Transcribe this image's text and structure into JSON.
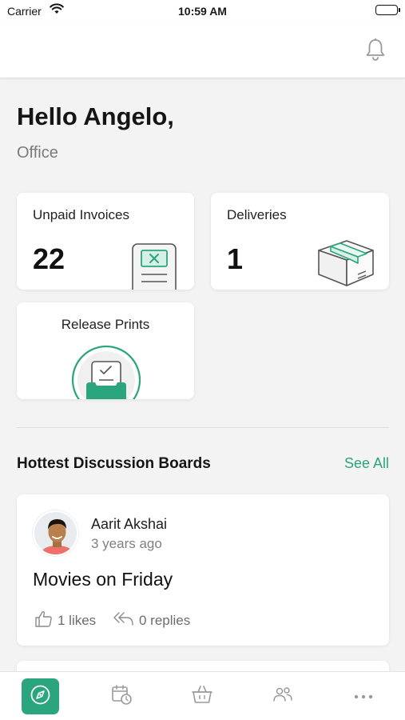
{
  "status_bar": {
    "carrier": "Carrier",
    "time": "10:59 AM"
  },
  "header": {
    "bell_icon": "bell-icon"
  },
  "greeting": {
    "title": "Hello Angelo,",
    "subtitle": "Office"
  },
  "cards": {
    "unpaid_invoices": {
      "label": "Unpaid Invoices",
      "count": "22",
      "icon": "invoice-icon"
    },
    "deliveries": {
      "label": "Deliveries",
      "count": "1",
      "icon": "package-icon"
    },
    "release_prints": {
      "label": "Release Prints",
      "icon": "printer-icon"
    }
  },
  "discussions": {
    "section_title": "Hottest Discussion Boards",
    "see_all": "See All",
    "posts": [
      {
        "author": "Aarit Akshai",
        "time": "3 years ago",
        "title": "Movies on Friday",
        "likes": "1 likes",
        "replies": "0 replies"
      }
    ]
  },
  "tabbar": {
    "items": [
      {
        "name": "explore",
        "icon": "compass-icon",
        "active": true
      },
      {
        "name": "bookings",
        "icon": "calendar-clock-icon",
        "active": false
      },
      {
        "name": "shop",
        "icon": "basket-icon",
        "active": false
      },
      {
        "name": "community",
        "icon": "people-icon",
        "active": false
      },
      {
        "name": "more",
        "icon": "more-icon",
        "active": false
      }
    ]
  },
  "colors": {
    "accent": "#2aa57e",
    "background": "#f3f3f3",
    "card": "#ffffff"
  }
}
